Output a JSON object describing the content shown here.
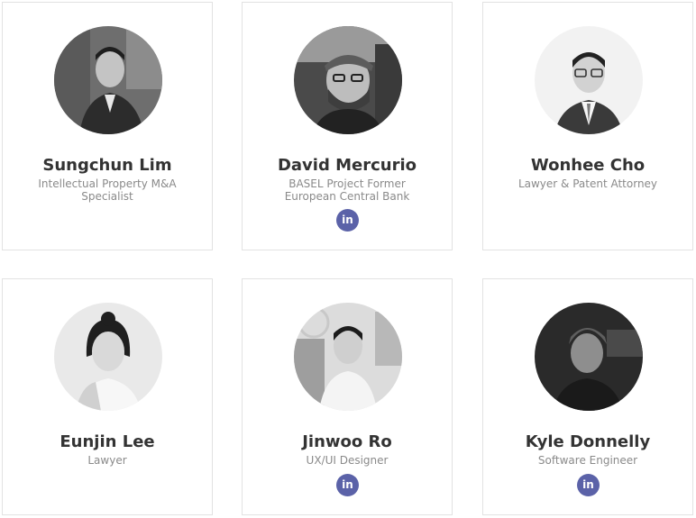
{
  "members": [
    {
      "name": "Sungchun Lim",
      "role": "Intellectual Property M&A Specialist"
    },
    {
      "name": "David Mercurio",
      "role": "BASEL Project Former European Central Bank",
      "linkedin": "in"
    },
    {
      "name": "Wonhee Cho",
      "role": "Lawyer & Patent Attorney"
    },
    {
      "name": "Eunjin Lee",
      "role": "Lawyer"
    },
    {
      "name": "Jinwoo Ro",
      "role": "UX/UI Designer",
      "linkedin": "in"
    },
    {
      "name": "Kyle Donnelly",
      "role": "Software Engineer",
      "linkedin": "in"
    }
  ],
  "icons": {
    "linkedin": "linkedin-icon"
  },
  "colors": {
    "linkedin_badge": "#5b62a8",
    "name_text": "#333333",
    "role_text": "#8a8a8a",
    "card_border": "#e2e2e2"
  }
}
